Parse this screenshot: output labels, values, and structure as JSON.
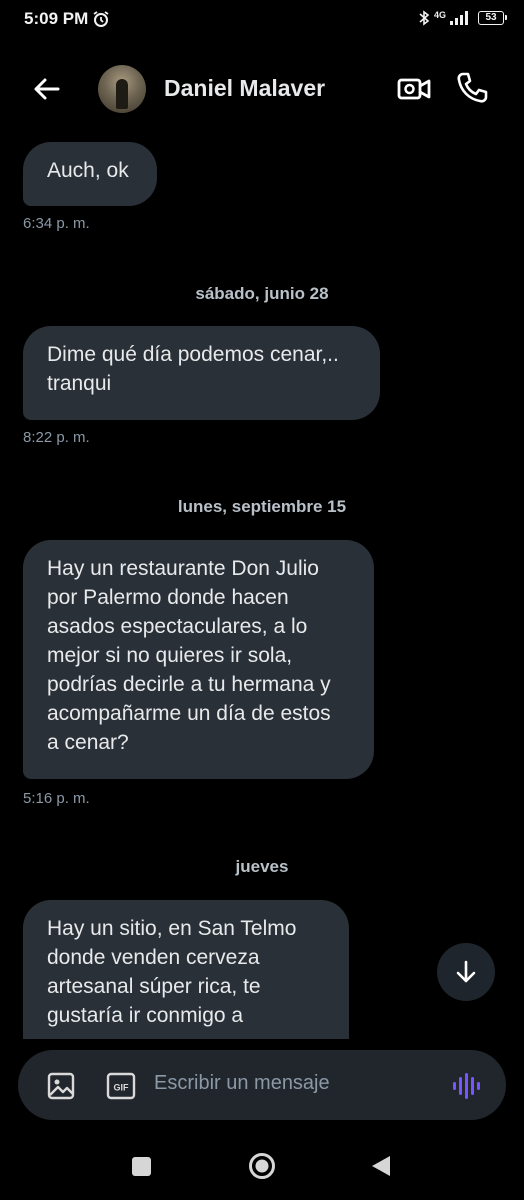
{
  "status_bar": {
    "time": "5:09 PM",
    "network": "4G",
    "battery": "53"
  },
  "header": {
    "contact_name": "Daniel Malaver"
  },
  "messages": [
    {
      "lines": [
        "Auch, ok"
      ],
      "time": "6:34 p. m."
    },
    {
      "date": "sábado, junio 28",
      "lines": [
        "Dime qué día podemos cenar,..",
        "tranqui"
      ],
      "time": "8:22 p. m."
    },
    {
      "date": "lunes, septiembre 15",
      "lines": [
        "Hay un restaurante Don Julio",
        "por Palermo donde hacen",
        "asados espectaculares, a lo",
        "mejor si no quieres ir sola,",
        "podrías decirle a tu hermana y",
        "acompañarme un día de estos",
        "a cenar?"
      ],
      "time": "5:16 p. m."
    },
    {
      "date": "jueves",
      "lines": [
        "Hay un sitio, en San Telmo",
        "donde venden cerveza",
        "artesanal súper rica, te",
        "gustaría ir conmigo a"
      ]
    }
  ],
  "composer": {
    "placeholder": "Escribir un mensaje",
    "gif_label": "GIF"
  },
  "colors": {
    "background": "#000000",
    "bubble": "#2a3038",
    "accent_voice": "#7856ff"
  },
  "icons": [
    "back-arrow-icon",
    "video-call-icon",
    "phone-icon",
    "image-icon",
    "gif-icon",
    "voice-icon",
    "arrow-down-icon",
    "alarm-icon",
    "bluetooth-icon",
    "signal-icon",
    "battery-icon"
  ]
}
